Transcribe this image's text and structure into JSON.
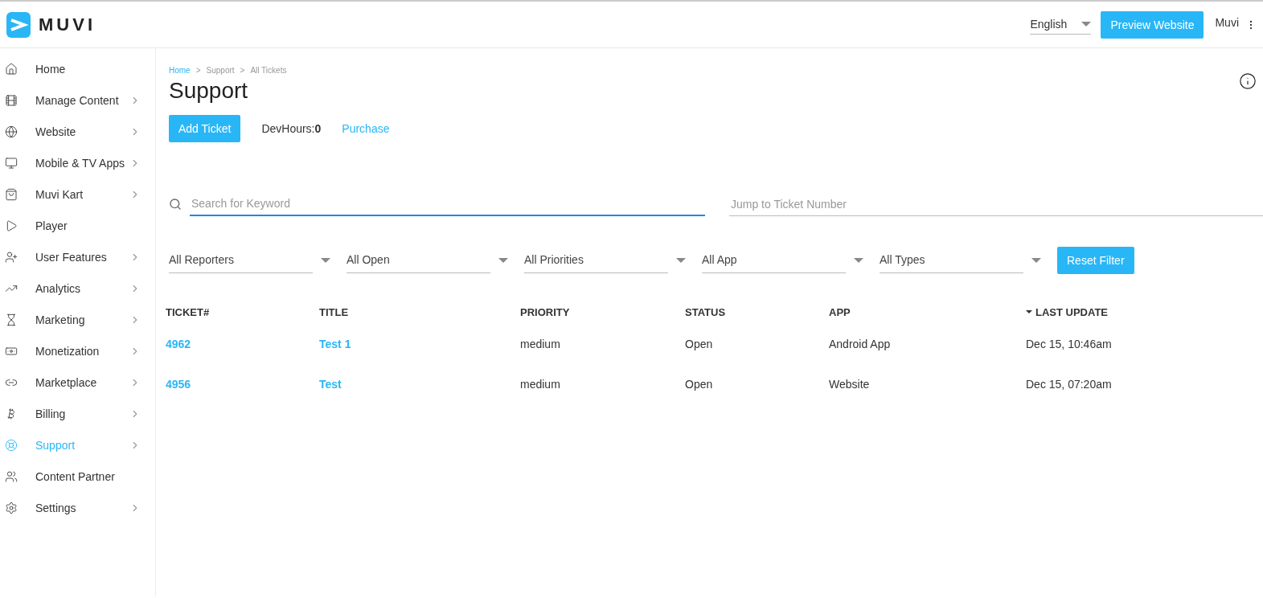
{
  "header": {
    "logo": "MUVI",
    "language": "English",
    "preview_button": "Preview Website",
    "user": "Muvi"
  },
  "sidebar": {
    "items": [
      {
        "label": "Home",
        "has_arrow": false,
        "selected": false
      },
      {
        "label": "Manage Content",
        "has_arrow": true,
        "selected": false
      },
      {
        "label": "Website",
        "has_arrow": true,
        "selected": false
      },
      {
        "label": "Mobile & TV Apps",
        "has_arrow": true,
        "selected": false
      },
      {
        "label": "Muvi Kart",
        "has_arrow": true,
        "selected": false
      },
      {
        "label": "Player",
        "has_arrow": false,
        "selected": false
      },
      {
        "label": "User Features",
        "has_arrow": true,
        "selected": false
      },
      {
        "label": "Analytics",
        "has_arrow": true,
        "selected": false
      },
      {
        "label": "Marketing",
        "has_arrow": true,
        "selected": false
      },
      {
        "label": "Monetization",
        "has_arrow": true,
        "selected": false
      },
      {
        "label": "Marketplace",
        "has_arrow": true,
        "selected": false
      },
      {
        "label": "Billing",
        "has_arrow": true,
        "selected": false
      },
      {
        "label": "Support",
        "has_arrow": true,
        "selected": true
      },
      {
        "label": "Content Partner",
        "has_arrow": false,
        "selected": false
      },
      {
        "label": "Settings",
        "has_arrow": true,
        "selected": false
      }
    ]
  },
  "breadcrumb": [
    {
      "label": "Home",
      "link": true
    },
    {
      "label": ">",
      "link": false
    },
    {
      "label": "Support",
      "link": false
    },
    {
      "label": ">",
      "link": false
    },
    {
      "label": "All Tickets",
      "link": false
    }
  ],
  "title": "Support",
  "actions": {
    "add_button": "Add Ticket",
    "devhours_label": "DevHours:",
    "devhours_value": "0",
    "purchase_link": "Purchase"
  },
  "search": {
    "placeholder": "Search for Keyword",
    "jump_placeholder": "Jump to Ticket Number"
  },
  "filters": [
    "All Reporters",
    "All Open",
    "All Priorities",
    "All App",
    "All Types"
  ],
  "reset_button": "Reset Filter",
  "table": {
    "columns": [
      {
        "label": "TICKET#",
        "sorted": false
      },
      {
        "label": "TITLE",
        "sorted": false
      },
      {
        "label": "PRIORITY",
        "sorted": false
      },
      {
        "label": "STATUS",
        "sorted": false
      },
      {
        "label": "APP",
        "sorted": false
      },
      {
        "label": "LAST UPDATE",
        "sorted": true
      }
    ],
    "rows": [
      {
        "ticket": "4962",
        "title": "Test 1",
        "priority": "medium",
        "status": "Open",
        "app": "Android App",
        "last_update": "Dec 15, 10:46am"
      },
      {
        "ticket": "4956",
        "title": "Test",
        "priority": "medium",
        "status": "Open",
        "app": "Website",
        "last_update": "Dec 15, 07:20am"
      }
    ]
  }
}
